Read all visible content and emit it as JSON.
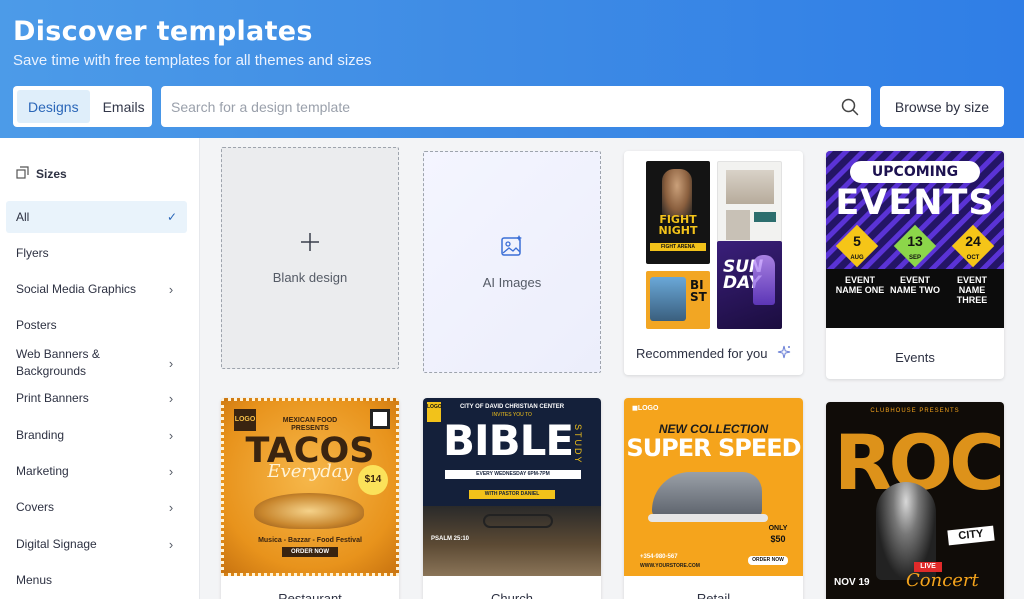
{
  "header": {
    "title": "Discover templates",
    "subtitle": "Save time with free templates for all themes and sizes",
    "tabs": [
      {
        "label": "Designs"
      },
      {
        "label": "Emails"
      }
    ],
    "search_placeholder": "Search for a design template",
    "browse_label": "Browse by size"
  },
  "sidebar": {
    "heading": "Sizes",
    "items": [
      {
        "label": "All"
      },
      {
        "label": "Flyers"
      },
      {
        "label": "Social Media Graphics"
      },
      {
        "label": "Posters"
      },
      {
        "label": "Web Banners & Backgrounds"
      },
      {
        "label": "Print Banners"
      },
      {
        "label": "Branding"
      },
      {
        "label": "Marketing"
      },
      {
        "label": "Covers"
      },
      {
        "label": "Digital Signage"
      },
      {
        "label": "Menus"
      }
    ]
  },
  "cards": {
    "blank": "Blank design",
    "ai": "AI Images",
    "recommended": "Recommended for you",
    "events": "Events",
    "restaurant": "Restaurant",
    "church": "Church",
    "retail": "Retail"
  },
  "posters": {
    "events": {
      "top": "UPCOMING",
      "big": "EVENTS",
      "dates": [
        [
          "5",
          "AUG"
        ],
        [
          "13",
          "SEP"
        ],
        [
          "24",
          "OCT"
        ]
      ],
      "names": [
        "EVENT\nNAME ONE",
        "EVENT\nNAME TWO",
        "EVENT\nNAME THREE"
      ]
    },
    "tacos": {
      "logo": "LOGO",
      "pre": "MEXICAN FOOD\nPRESENTS",
      "big": "TACOS",
      "script": "Everyday",
      "price": "$14",
      "foot": "Musica - Bazzar - Food Festival",
      "order": "ORDER NOW"
    },
    "bible": {
      "logo": "LOGO",
      "center": "CITY OF DAVID CHRISTIAN CENTER",
      "invite": "INVITES YOU TO",
      "big": "BIBLE",
      "side": "STUDY",
      "when": "EVERY WEDNESDAY  6PM-7PM",
      "pastor": "WITH PASTOR DANIEL",
      "psalm": "PSALM 25:10"
    },
    "retail": {
      "logo": "LOGO",
      "line1": "NEW COLLECTION",
      "line2": "SUPER SPEED",
      "only": "ONLY",
      "price": "$50",
      "order": "ORDER NOW",
      "phone": "+354-980-567",
      "site": "WWW.YOURSTORE.COM"
    },
    "rock": {
      "club": "CLUBHOUSE PRESENTS",
      "big": "ROCK",
      "city": "CITY",
      "live": "LIVE",
      "concert": "Concert",
      "date": "NOV 19"
    },
    "rec": {
      "fight1": "FIGHT",
      "fight2": "NIGHT",
      "fight3": "FIGHT ARENA",
      "sun1": "SUN",
      "sun2": "DAY"
    }
  }
}
